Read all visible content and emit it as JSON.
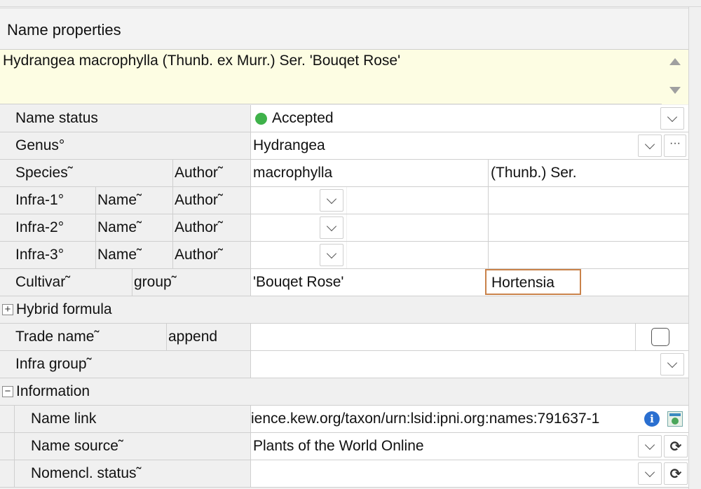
{
  "panel": {
    "title": "Name properties",
    "full_name": "Hydrangea macrophylla (Thunb. ex Murr.) Ser. 'Bouqet Rose'"
  },
  "rows": {
    "name_status": {
      "label": "Name status",
      "value": "Accepted",
      "status_color": "#3fb24a"
    },
    "genus": {
      "label": "Genus°",
      "value": "Hydrangea",
      "more": "···"
    },
    "species": {
      "label": "Species˜",
      "author_label": "Author˜",
      "value": "macrophylla",
      "author": "(Thunb.) Ser."
    },
    "infra1": {
      "label": "Infra-1°",
      "name_label": "Name˜",
      "author_label": "Author˜"
    },
    "infra2": {
      "label": "Infra-2°",
      "name_label": "Name˜",
      "author_label": "Author˜"
    },
    "infra3": {
      "label": "Infra-3°",
      "name_label": "Name˜",
      "author_label": "Author˜"
    },
    "cultivar": {
      "label": "Cultivar˜",
      "group_label": "group˜",
      "value": "'Bouqet Rose'",
      "group_value": "Hortensia"
    },
    "hybrid": {
      "toggle": "+",
      "label": "Hybrid formula"
    },
    "trade_name": {
      "label": "Trade name˜",
      "append_label": "append"
    },
    "infra_group": {
      "label": "Infra group˜"
    },
    "information": {
      "toggle": "−",
      "label": "Information"
    },
    "name_link": {
      "label": "Name link",
      "value": "ience.kew.org/taxon/urn:lsid:ipni.org:names:791637-1",
      "info": "i"
    },
    "name_source": {
      "label": "Name source˜",
      "value": "Plants of the World Online",
      "refresh": "⟳"
    },
    "nomencl_status": {
      "label": "Nomencl. status˜",
      "refresh": "⟳"
    }
  },
  "icons": {
    "dropdown": "chevron-down-icon",
    "info": "info-icon",
    "web": "web-link-icon",
    "refresh": "refresh-icon"
  },
  "colors": {
    "name_background": "#fdfde3",
    "accepted_dot": "#3fb24a",
    "focus_border": "#c9824a",
    "info_blue": "#2a6fd0"
  }
}
